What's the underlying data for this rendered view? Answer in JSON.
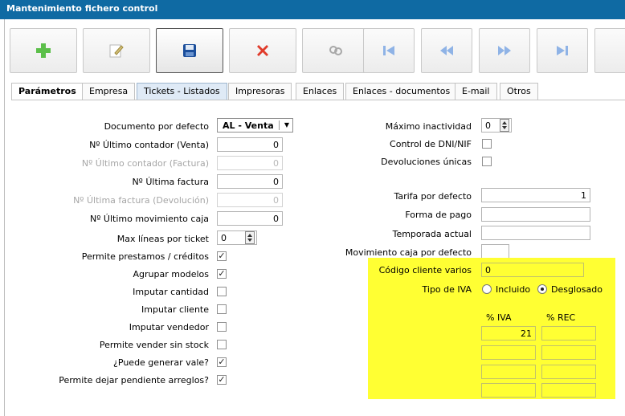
{
  "window": {
    "title": "Mantenimiento fichero control"
  },
  "toolbar": {
    "buttons": [
      {
        "icon": "add-icon"
      },
      {
        "icon": "edit-icon"
      },
      {
        "icon": "save-icon"
      },
      {
        "icon": "delete-icon"
      },
      {
        "icon": "search-icon"
      },
      {
        "icon": "first-icon"
      },
      {
        "icon": "previous-icon"
      },
      {
        "icon": "next-icon"
      },
      {
        "icon": "last-icon"
      }
    ]
  },
  "tabs": [
    "Parámetros",
    "Empresa",
    "Tickets - Listados",
    "Impresoras",
    "Enlaces",
    "Enlaces - documentos",
    "E-mail",
    "Otros"
  ],
  "left": {
    "documento_label": "Documento por defecto",
    "documento_value": "AL - Venta",
    "ult_contador_venta_label": "Nº Último contador (Venta)",
    "ult_contador_venta_value": "0",
    "ult_contador_factura_label": "Nº Último contador (Factura)",
    "ult_contador_factura_value": "0",
    "ult_factura_label": "Nº Última factura",
    "ult_factura_value": "0",
    "ult_factura_dev_label": "Nº Última factura (Devolución)",
    "ult_factura_dev_value": "0",
    "ult_mov_caja_label": "Nº Último movimiento caja",
    "ult_mov_caja_value": "0",
    "max_lineas_label": "Max líneas por ticket",
    "max_lineas_value": "0",
    "checkboxes": [
      {
        "label": "Permite prestamos / créditos",
        "checked": true
      },
      {
        "label": "Agrupar modelos",
        "checked": true
      },
      {
        "label": "Imputar cantidad",
        "checked": false
      },
      {
        "label": "Imputar cliente",
        "checked": false
      },
      {
        "label": "Imputar vendedor",
        "checked": false
      },
      {
        "label": "Permite vender sin stock",
        "checked": false
      },
      {
        "label": "¿Puede generar vale?",
        "checked": true
      },
      {
        "label": "Permite dejar pendiente arreglos?",
        "checked": true
      }
    ],
    "check_mark": "✓"
  },
  "right": {
    "max_inactividad_label": "Máximo inactividad",
    "max_inactividad_value": "0",
    "control_dni_label": "Control de DNI/NIF",
    "devoluciones_label": "Devoluciones únicas",
    "tarifa_label": "Tarifa por defecto",
    "tarifa_value": "1",
    "forma_pago_label": "Forma de pago",
    "temporada_label": "Temporada actual",
    "mov_caja_label": "Movimiento caja por defecto",
    "codigo_cliente_label": "Código cliente varios",
    "codigo_cliente_value": "0",
    "tipo_iva_label": "Tipo de IVA",
    "incluido_label": "Incluido",
    "desglosado_label": "Desglosado",
    "selected_iva": "Desglosado",
    "iva_header": "% IVA",
    "rec_header": "% REC",
    "iva_rows": [
      {
        "iva": "21",
        "rec": ""
      },
      {
        "iva": "",
        "rec": ""
      },
      {
        "iva": "",
        "rec": ""
      },
      {
        "iva": "",
        "rec": ""
      }
    ]
  },
  "colors": {
    "titlebar": "#0f6aa3",
    "highlight": "#ffff33",
    "add": "#4caf50",
    "delete": "#e03b2b",
    "save": "#1b4e9b",
    "nav": "#8fb3e6"
  }
}
